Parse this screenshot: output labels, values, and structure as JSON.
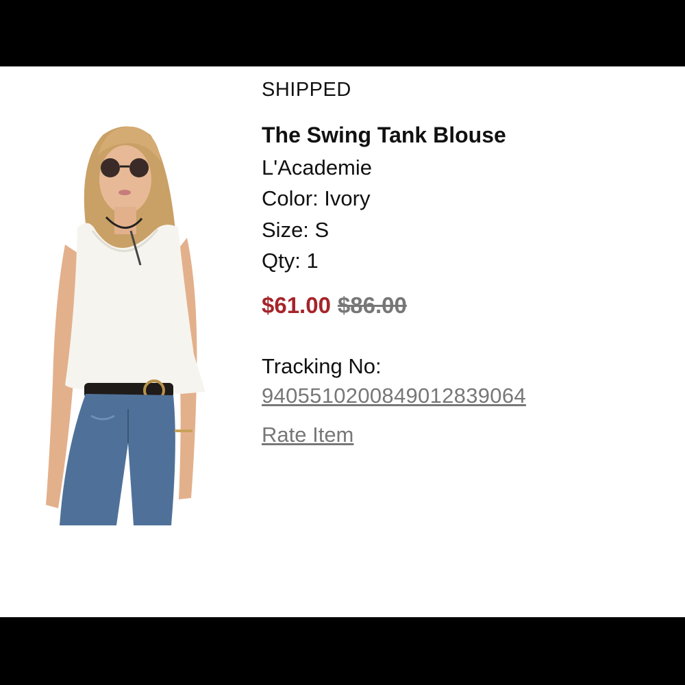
{
  "order_item": {
    "status": "SHIPPED",
    "product_name": "The Swing Tank Blouse",
    "brand": "L'Academie",
    "color_line": "Color: Ivory",
    "size_line": "Size: S",
    "qty_line": "Qty: 1",
    "sale_price": "$61.00",
    "original_price": "$86.00",
    "tracking_label": "Tracking No:",
    "tracking_number": "9405510200849012839064",
    "rate_label": "Rate Item"
  },
  "colors": {
    "sale_price": "#a5252a",
    "muted": "#777777"
  }
}
